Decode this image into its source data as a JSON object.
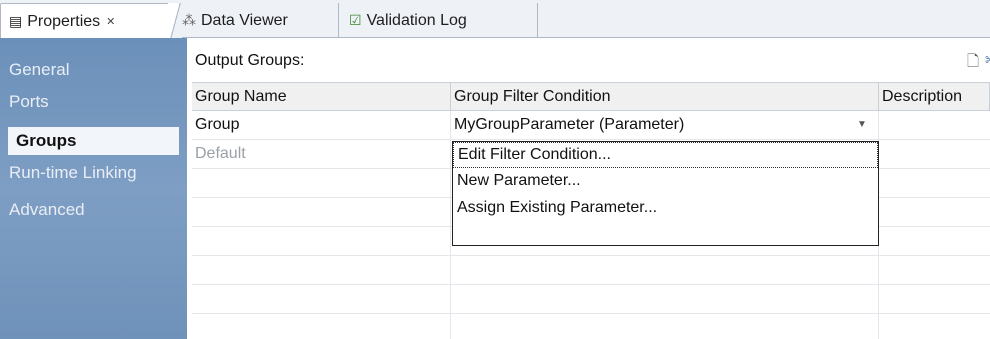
{
  "tabs": [
    {
      "label": "Properties",
      "icon": "properties-icon",
      "active": true
    },
    {
      "label": "Data Viewer",
      "icon": "data-viewer-icon",
      "active": false
    },
    {
      "label": "Validation Log",
      "icon": "validation-log-icon",
      "active": false
    }
  ],
  "close_glyph": "✕",
  "nav": {
    "items": [
      {
        "label": "General"
      },
      {
        "label": "Ports"
      },
      {
        "label": "Groups",
        "active": true
      },
      {
        "label": "Run-time Linking"
      },
      {
        "label": "Advanced"
      }
    ]
  },
  "main": {
    "section_label": "Output Groups:",
    "toolbar": [
      "new-icon",
      "cut-icon"
    ],
    "table": {
      "headers": [
        "Group Name",
        "Group Filter Condition",
        "Description"
      ],
      "rows": [
        {
          "name": "Group",
          "condition": "MyGroupParameter (Parameter)",
          "description": ""
        },
        {
          "name": "Default",
          "condition": "",
          "description": ""
        }
      ]
    },
    "dropdown": {
      "options": [
        "Edit Filter Condition...",
        "New Parameter...",
        "Assign Existing Parameter..."
      ],
      "focused": "Edit Filter Condition..."
    }
  },
  "colors": {
    "nav_bg": "#7e9ec4",
    "nav_active_bg": "#f2f5f9",
    "muted_text": "#9aa0a8"
  }
}
